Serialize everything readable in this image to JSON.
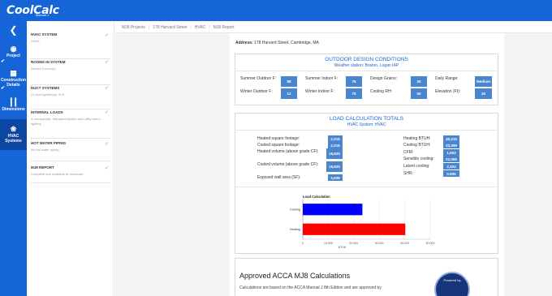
{
  "app": {
    "logo_text": "CoolCalc",
    "logo_tm": "Manual J"
  },
  "nav": {
    "items": [
      {
        "label": "Project",
        "icon": "map-pin-icon",
        "checked": true
      },
      {
        "label": "Construction Details",
        "icon": "blueprint-icon",
        "checked": true
      },
      {
        "label": "Dimensions",
        "icon": "ruler-icon",
        "checked": false
      },
      {
        "label": "HVAC Systems",
        "icon": "fan-icon",
        "checked": false,
        "active": true
      }
    ]
  },
  "steps": [
    {
      "title": "HVAC SYSTEM",
      "sub": "HVAC"
    },
    {
      "title": "ROOMS IN SYSTEM",
      "sub": "Serves 3 room(s)"
    },
    {
      "title": "DUCT SYSTEMS",
      "sub": "(1) duct system(s), R-8"
    },
    {
      "title": "INTERNAL LOADS",
      "sub": "4 occupant(s), Standard kitchen and utility room, lighting"
    },
    {
      "title": "HOT WATER PIPING",
      "sub": "No hot water piping"
    },
    {
      "title": "MJ8 REPORT",
      "sub": "Complete and available to download"
    }
  ],
  "breadcrumb": [
    "MJ8 Projects",
    "178 Harvard Street",
    "HVAC",
    "MJ8 Report"
  ],
  "address": {
    "label": "Address:",
    "value": "178 Harvard Street, Cambridge, MA"
  },
  "outdoor": {
    "title": "OUTDOOR DESIGN CONDITIONS",
    "subtitle": "Weather station: Boston, Logan IAP",
    "rows": [
      [
        {
          "label": "Summer Outdoor F:",
          "value": "88"
        },
        {
          "label": "Summer Indoor F:",
          "value": "75"
        },
        {
          "label": "Design Grains:",
          "value": "26"
        },
        {
          "label": "Daily Range:",
          "value": "Medium"
        }
      ],
      [
        {
          "label": "Winter Outdoor F:",
          "value": "12"
        },
        {
          "label": "Winter Indoor F:",
          "value": "70"
        },
        {
          "label": "Cooling RH:",
          "value": "50"
        },
        {
          "label": "Elevation (Ft):",
          "value": "30"
        }
      ]
    ]
  },
  "totals": {
    "title": "LOAD CALCULATION TOTALS",
    "subtitle": "HVAC System: HVAC",
    "left": [
      {
        "label": "Heated square footage:",
        "value": "2,215"
      },
      {
        "label": "Cooled square footage:",
        "value": "2,215"
      },
      {
        "label": "Heated volume (above grade CF):",
        "value": "19,630"
      },
      {
        "label": "Cooled volume (above grade CF):",
        "value": "19,630"
      },
      {
        "label": "Exposed wall area (SF):",
        "value": "3,039"
      }
    ],
    "right": [
      {
        "label": "Heating BTUH:",
        "value": "40,215"
      },
      {
        "label": "Cooling BTUH:",
        "value": "23,389"
      },
      {
        "label": "CFM:",
        "value": "1,063"
      },
      {
        "label": "Sensible cooling:",
        "value": "21,065"
      },
      {
        "label": "Latent cooling:",
        "value": "2,324"
      },
      {
        "label": "SHR:",
        "value": "0.905"
      }
    ]
  },
  "chart_data": {
    "type": "bar",
    "title": "Load Calculation",
    "orientation": "horizontal",
    "categories": [
      "Cooling",
      "Heating"
    ],
    "values": [
      23389,
      40215
    ],
    "colors": [
      "#0000ff",
      "#ff0000"
    ],
    "xlabel": "BTUH",
    "xlim": [
      0,
      50000
    ],
    "ticks": [
      "0",
      "10,000",
      "20,000",
      "30,000",
      "40,000",
      "50,000"
    ],
    "grid": true
  },
  "acca": {
    "title": "Approved ACCA MJ8 Calculations",
    "text": "Calculations are based on the ACCA Manual J 8th Edition and are approved by",
    "badge_text": "Powered by"
  }
}
